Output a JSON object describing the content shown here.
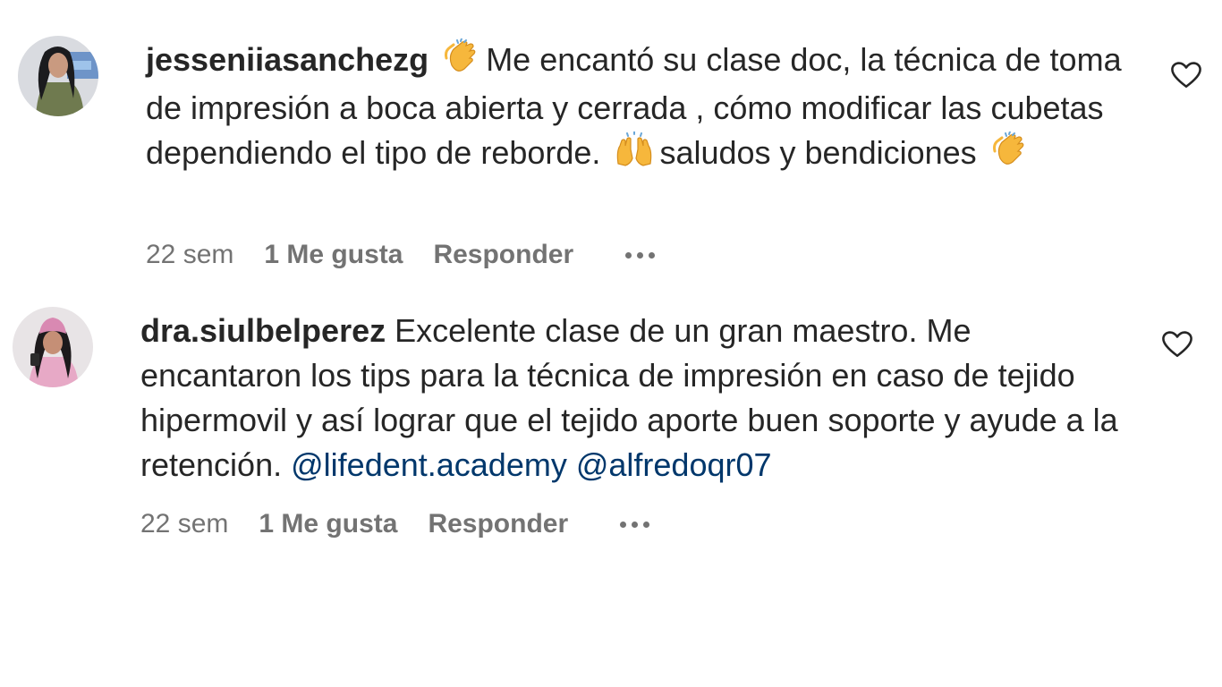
{
  "comments": [
    {
      "username": "jesseniiasanchezg",
      "text_1": "Me encantó su clase doc, la técnica de toma de impresión a boca abierta y cerrada , cómo modificar las cubetas dependiendo el tipo de reborde.",
      "text_2": "saludos y bendiciones",
      "emojis": [
        "clapping-hands",
        "raising-hands",
        "clapping-hands"
      ],
      "time": "22 sem",
      "likes": "1 Me gusta",
      "reply": "Responder"
    },
    {
      "username": "dra.siulbelperez",
      "text_1": "Excelente clase de un gran maestro. Me encantaron los tips para la técnica de impresión en caso de tejido hipermovil y así lograr que el tejido aporte buen soporte y ayude a la retención.",
      "mention_1": "@lifedent.academy",
      "mention_2": "@alfredoqr07",
      "time": "22 sem",
      "likes": "1 Me gusta",
      "reply": "Responder"
    }
  ],
  "colors": {
    "text": "#262626",
    "secondary": "#737373",
    "mention": "#00376b",
    "background": "#ffffff"
  }
}
